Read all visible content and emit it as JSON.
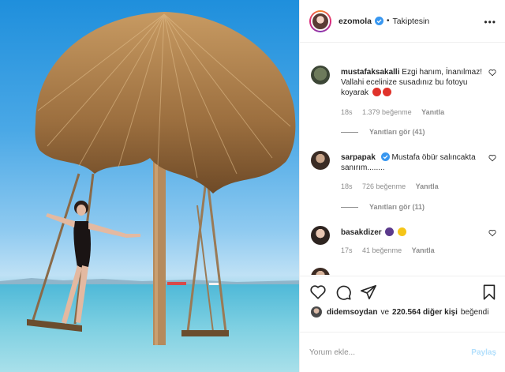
{
  "post": {
    "username": "ezomola",
    "follow_state": "Takiptesin",
    "more_label": "•••"
  },
  "comments": [
    {
      "username": "mustafaksakalli",
      "text": "Ezgi hanım, İnanılmaz! Vallahi ecelinize susadınız bu fotoyu koyarak",
      "time": "18s",
      "likes": "1.379 beğenme",
      "reply_label": "Yanıtla",
      "view_replies": "Yanıtları gör (41)"
    },
    {
      "username": "sarpapak",
      "text": "Mustafa öbür salıncakta sanırım........",
      "time": "18s",
      "likes": "726 beğenme",
      "reply_label": "Yanıtla",
      "view_replies": "Yanıtları gör (11)"
    },
    {
      "username": "basakdizer",
      "text": "",
      "time": "17s",
      "likes": "41 beğenme",
      "reply_label": "Yanıtla"
    }
  ],
  "liked_by": {
    "user": "didemsoydan",
    "connector": "ve",
    "others": "220.564 diğer kişi",
    "suffix": "beğendi"
  },
  "add_comment": {
    "placeholder": "Yorum ekle...",
    "post_label": "Paylaş"
  },
  "icons": [
    "more-icon",
    "verified-badge-icon",
    "heart-icon",
    "comment-icon",
    "share-icon",
    "bookmark-icon"
  ],
  "colors": {
    "verified": "#3897f0",
    "link_disabled": "#b2dffc",
    "meta": "#8e8e8e"
  }
}
